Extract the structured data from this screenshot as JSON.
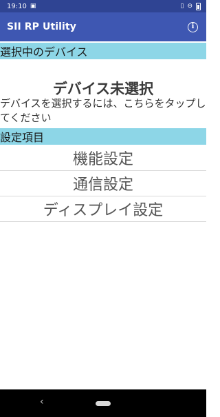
{
  "status_bar": {
    "time": "19:10",
    "icons": [
      "image-icon",
      "vibrate-icon",
      "do-not-disturb-icon",
      "battery-icon"
    ]
  },
  "app_bar": {
    "title": "SII RP Utility",
    "info_icon": "info-icon"
  },
  "selected_device_section": {
    "header": "選択中のデバイス",
    "device_name": "デバイス未選択",
    "hint": "デバイスを選択するには、こちらをタップしてください"
  },
  "settings_section": {
    "header": "設定項目",
    "items": [
      {
        "label": "機能設定"
      },
      {
        "label": "通信設定"
      },
      {
        "label": "ディスプレイ設定"
      }
    ]
  },
  "nav_bar": {
    "back_icon": "back-icon",
    "home_icon": "home-pill-icon"
  },
  "colors": {
    "status_bar": "#2f4493",
    "app_bar": "#3e57b2",
    "section_header": "#8dd6e7"
  }
}
